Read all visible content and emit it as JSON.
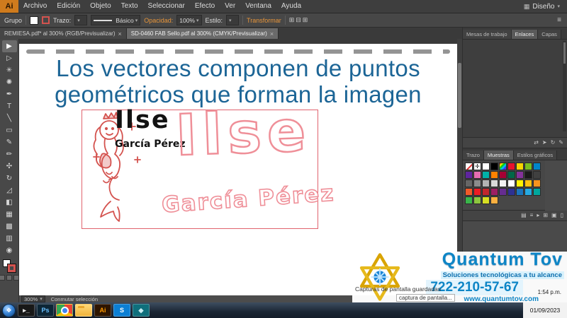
{
  "app": {
    "logo_text": "Ai",
    "workspace_label": "Diseño",
    "close_glyph": "×"
  },
  "menu": {
    "items": [
      "Archivo",
      "Edición",
      "Objeto",
      "Texto",
      "Seleccionar",
      "Efecto",
      "Ver",
      "Ventana",
      "Ayuda"
    ]
  },
  "control_bar": {
    "context_label": "Grupo",
    "stroke_label": "Trazo:",
    "brush_value": "Básico",
    "opacity_label": "Opacidad:",
    "opacity_value": "100%",
    "style_label": "Estilo:",
    "transform_label": "Transformar"
  },
  "document_tabs": [
    {
      "label": "REMIESA.pdf* al 300% (RGB/Previsualizar)",
      "active": false
    },
    {
      "label": "SD-0460 FAB Sello.pdf al 300% (CMYK/Previsualizar)",
      "active": true
    }
  ],
  "toolbar": {
    "tools": [
      {
        "name": "selection-tool",
        "glyph": "▶",
        "active": true
      },
      {
        "name": "direct-selection-tool",
        "glyph": "▷"
      },
      {
        "name": "magic-wand-tool",
        "glyph": "✳"
      },
      {
        "name": "lasso-tool",
        "glyph": "✺"
      },
      {
        "name": "pen-tool",
        "glyph": "✒"
      },
      {
        "name": "type-tool",
        "glyph": "T"
      },
      {
        "name": "line-segment-tool",
        "glyph": "╲"
      },
      {
        "name": "rectangle-tool",
        "glyph": "▭"
      },
      {
        "name": "paintbrush-tool",
        "glyph": "✎"
      },
      {
        "name": "pencil-tool",
        "glyph": "✏"
      },
      {
        "name": "width-tool",
        "glyph": "✣"
      },
      {
        "name": "rotate-tool",
        "glyph": "↻"
      },
      {
        "name": "scale-tool",
        "glyph": "◿"
      },
      {
        "name": "shape-builder-tool",
        "glyph": "◧"
      },
      {
        "name": "perspective-grid-tool",
        "glyph": "▦"
      },
      {
        "name": "mesh-tool",
        "glyph": "▩"
      },
      {
        "name": "gradient-tool",
        "glyph": "▥"
      },
      {
        "name": "eyedropper-tool",
        "glyph": "◉"
      }
    ]
  },
  "canvas": {
    "heading_line1": "Los vectores componen de puntos",
    "heading_line2": "geométricos que forman la imagen",
    "artwork": {
      "name_filled": "Ilse",
      "surname_filled": "García Pérez",
      "name_outline": "Ilse",
      "surname_outline": "García Pérez"
    }
  },
  "dock": {
    "top_tabs": [
      {
        "label": "Mesas de trabajo",
        "active": false
      },
      {
        "label": "Enlaces",
        "active": true
      },
      {
        "label": "Capas",
        "active": false
      }
    ],
    "swatch_tabs": [
      {
        "label": "Trazo",
        "active": false
      },
      {
        "label": "Muestras",
        "active": true
      },
      {
        "label": "Estilos gráficos",
        "active": false
      }
    ],
    "swatches": [
      "none",
      "reg",
      "#ffffff",
      "#000000",
      "grad",
      "#e8112d",
      "#f6d500",
      "#78be20",
      "#0085ca",
      "#5f259f",
      "#e56db1",
      "#00b2a9",
      "#ff8200",
      "#a50034",
      "#006747",
      "#84329b",
      "#1a1a1a",
      "#404040",
      "#666666",
      "#8c8c8c",
      "#b3b3b3",
      "#d9d9d9",
      "#f2f2f2",
      "#ffffff",
      "#fff200",
      "#ffc20e",
      "#f7941d",
      "#f15a29",
      "#ed1c24",
      "#c1272d",
      "#9e1f63",
      "#662d91",
      "#2e3192",
      "#1b75bc",
      "#27aae1",
      "#00a79d",
      "#39b54a",
      "#8dc63f",
      "#d7df23",
      "#fbb040"
    ],
    "links_footer_icons": [
      {
        "name": "relink-icon",
        "glyph": "⇄"
      },
      {
        "name": "go-to-link-icon",
        "glyph": "➤"
      },
      {
        "name": "update-link-icon",
        "glyph": "↻"
      },
      {
        "name": "edit-original-icon",
        "glyph": "✎"
      }
    ],
    "swatch_footer_icons": [
      {
        "name": "swatch-libraries-icon",
        "glyph": "▤"
      },
      {
        "name": "swatch-kinds-icon",
        "glyph": "≡"
      },
      {
        "name": "swatch-options-icon",
        "glyph": "▸"
      },
      {
        "name": "new-swatch-group-icon",
        "glyph": "⊞"
      },
      {
        "name": "new-swatch-icon",
        "glyph": "▣"
      },
      {
        "name": "delete-swatch-icon",
        "glyph": "▯"
      }
    ]
  },
  "status_bar": {
    "zoom": "300%",
    "hint": "Conmutar selección"
  },
  "branding": {
    "name": "Quantum Tov",
    "tagline": "Soluciones tecnológicas a tu alcance",
    "phone": "722-210-57-67",
    "website": "www.quantumtov.com"
  },
  "notification": {
    "title": "Capturas de pantalla guardadas",
    "item": "captura de pantalla...",
    "time": "1:54 p.m."
  },
  "taskbar": {
    "items": [
      {
        "name": "console-icon",
        "glyph": "▸_",
        "bg": "#181818",
        "fg": "#e6e6e6"
      },
      {
        "name": "photoshop-icon",
        "glyph": "Ps",
        "bg": "#0d2636",
        "fg": "#69c0ff"
      },
      {
        "name": "chrome-icon",
        "style": "chrome"
      },
      {
        "name": "file-explorer-icon",
        "style": "folder"
      },
      {
        "name": "illustrator-icon",
        "glyph": "Ai",
        "bg": "#2e1500",
        "fg": "#ff9a00"
      },
      {
        "name": "skype-icon",
        "glyph": "S",
        "bg": "#0b7fd4",
        "fg": "#ffffff"
      },
      {
        "name": "media-app-icon",
        "glyph": "◆",
        "bg": "#0f6f7c",
        "fg": "#c8ecf2"
      }
    ],
    "clock_date": "01/09/2023"
  },
  "colors": {
    "heading_blue": "#1c6596",
    "outline_pink": "#ef8f98",
    "selection_red": "#e0636e",
    "sketch_red": "#d4534f",
    "brand_blue": "#0d85c6",
    "star_gold": "#d9a404",
    "accent_orange": "#e8953a"
  }
}
